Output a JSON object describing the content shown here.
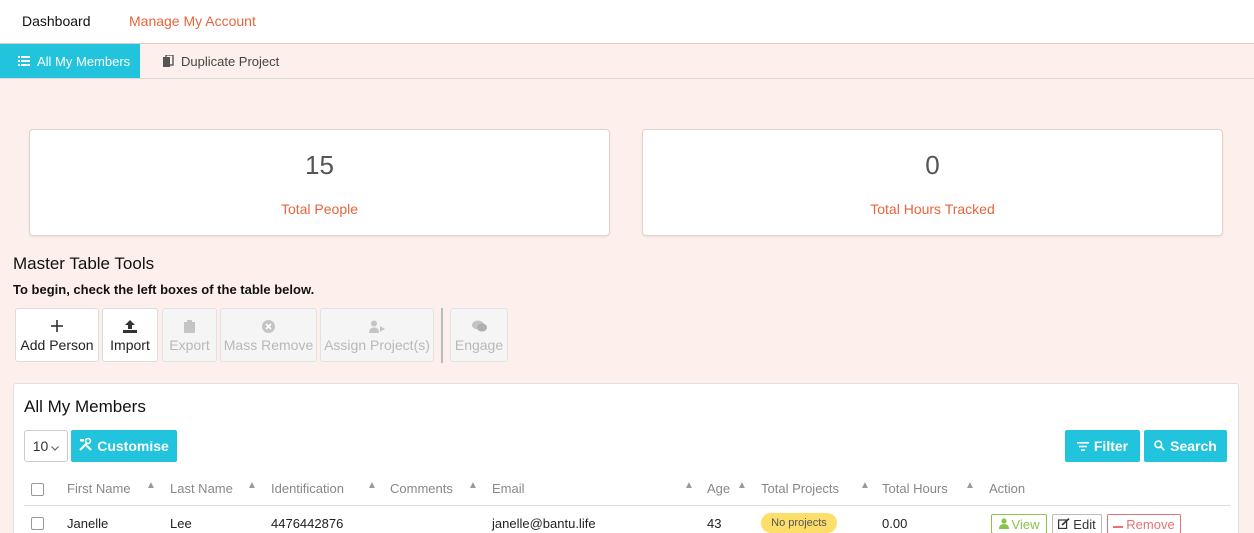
{
  "topnav": {
    "dashboard": "Dashboard",
    "manage_account": "Manage My Account"
  },
  "tabs": [
    {
      "label": "All My Members",
      "icon": "list-icon",
      "active": true
    },
    {
      "label": "Duplicate Project",
      "icon": "copy-icon",
      "active": false
    }
  ],
  "stats": {
    "people": {
      "value": "15",
      "label": "Total People"
    },
    "hours": {
      "value": "0",
      "label": "Total Hours Tracked"
    }
  },
  "tools": {
    "title": "Master Table Tools",
    "subtitle": "To begin, check the left boxes of the table below.",
    "buttons": [
      {
        "label": "Add Person",
        "icon": "plus-icon",
        "enabled": true
      },
      {
        "label": "Import",
        "icon": "upload-icon",
        "enabled": true
      },
      {
        "label": "Export",
        "icon": "clipboard-icon",
        "enabled": false
      },
      {
        "label": "Mass Remove",
        "icon": "times-circle-icon",
        "enabled": false
      },
      {
        "label": "Assign Project(s)",
        "icon": "user-share-icon",
        "enabled": false
      },
      {
        "label": "Engage",
        "icon": "chat-icon",
        "enabled": false
      }
    ]
  },
  "members": {
    "title": "All My Members",
    "page_size": "10",
    "customise_label": "Customise",
    "filter_label": "Filter",
    "search_label": "Search",
    "columns": [
      "First Name",
      "Last Name",
      "Identification",
      "Comments",
      "Email",
      "Age",
      "Total Projects",
      "Total Hours",
      "Action"
    ],
    "rows": [
      {
        "first_name": "Janelle",
        "last_name": "Lee",
        "identification": "4476442876",
        "comments": "",
        "email": "janelle@bantu.life",
        "age": "43",
        "projects": "No projects",
        "hours": "0.00",
        "actions": {
          "view": "View",
          "edit": "Edit",
          "remove": "Remove"
        }
      }
    ]
  },
  "colors": {
    "accent": "#22c3dc",
    "orange": "#e8643c",
    "background": "#fdf0ec",
    "badge": "#fdde6b",
    "view": "#8bc34a",
    "remove": "#e57373"
  }
}
